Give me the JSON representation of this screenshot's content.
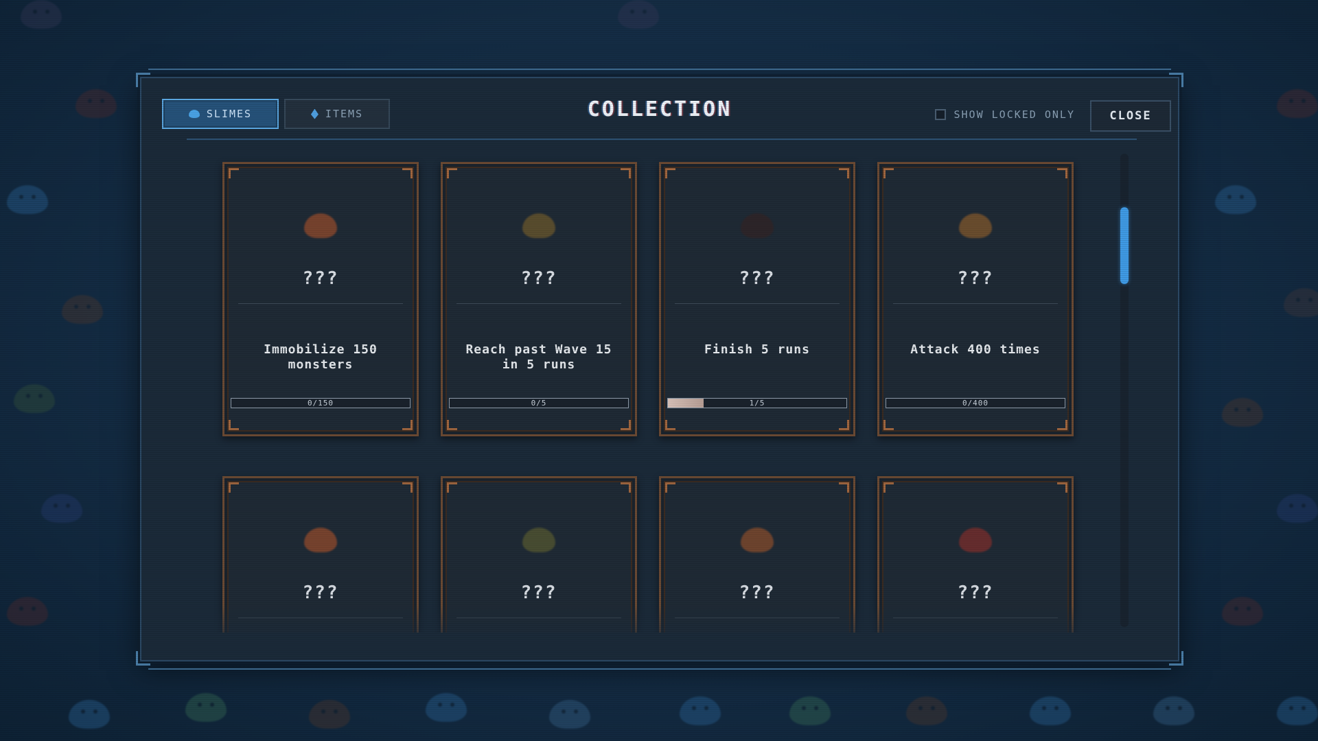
{
  "tabs": [
    {
      "label": "SLIMES",
      "icon": "slime-icon",
      "active": true
    },
    {
      "label": "ITEMS",
      "icon": "gem-icon",
      "active": false
    }
  ],
  "title": "COLLECTION",
  "filter": {
    "label": "SHOW LOCKED ONLY",
    "checked": false
  },
  "close_label": "CLOSE",
  "cards": [
    {
      "name": "???",
      "objective": "Immobilize 150 monsters",
      "progress": {
        "current": 0,
        "total": 150,
        "label": "0/150"
      },
      "sprite_color": "#c0582a"
    },
    {
      "name": "???",
      "objective": "Reach past Wave 15 in 5 runs",
      "progress": {
        "current": 0,
        "total": 5,
        "label": "0/5"
      },
      "sprite_color": "#8a6a2a"
    },
    {
      "name": "???",
      "objective": "Finish 5 runs",
      "progress": {
        "current": 1,
        "total": 5,
        "label": "1/5"
      },
      "sprite_color": "#3a2220"
    },
    {
      "name": "???",
      "objective": "Attack 400 times",
      "progress": {
        "current": 0,
        "total": 400,
        "label": "0/400"
      },
      "sprite_color": "#a86a2a"
    },
    {
      "name": "???",
      "objective": "",
      "progress": null,
      "sprite_color": "#c0582a"
    },
    {
      "name": "???",
      "objective": "",
      "progress": null,
      "sprite_color": "#6a6a30"
    },
    {
      "name": "???",
      "objective": "",
      "progress": null,
      "sprite_color": "#b05a2a"
    },
    {
      "name": "???",
      "objective": "",
      "progress": null,
      "sprite_color": "#a0302a"
    }
  ],
  "colors": {
    "accent": "#3f9ae4",
    "card_border": "#a0663f",
    "panel_bg": "#1b2a39"
  }
}
